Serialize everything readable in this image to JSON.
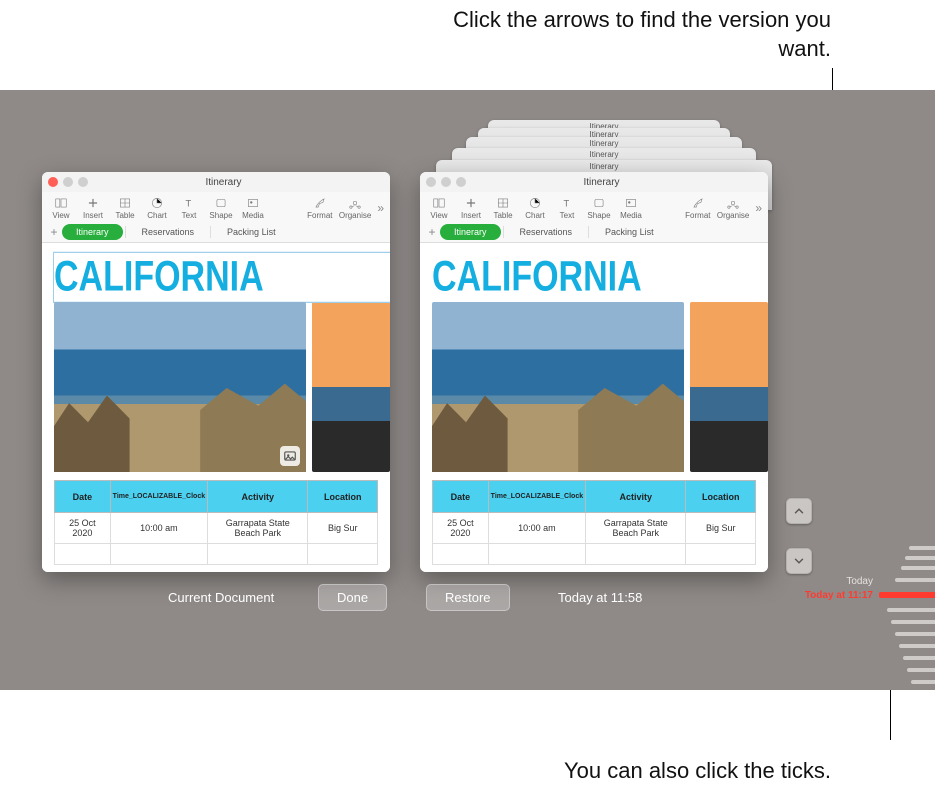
{
  "annotations": {
    "top": "Click the arrows to find the version you want.",
    "bottom": "You can also click the ticks."
  },
  "ghost_title": "Itinerary",
  "window": {
    "title": "Itinerary",
    "toolbar": {
      "view": "View",
      "insert": "Insert",
      "table": "Table",
      "chart": "Chart",
      "text": "Text",
      "shape": "Shape",
      "media": "Media",
      "format": "Format",
      "organise": "Organise"
    },
    "tabs": {
      "itinerary": "Itinerary",
      "reservations": "Reservations",
      "packing": "Packing List"
    },
    "heading": "CALIFORNIA",
    "table": {
      "headers": {
        "date": "Date",
        "time": "Time_LOCALIZABLE_Clock",
        "activity": "Activity",
        "location": "Location"
      },
      "row": {
        "date": "25 Oct 2020",
        "time": "10:00 am",
        "activity": "Garrapata State Beach Park",
        "location": "Big Sur"
      }
    }
  },
  "left": {
    "label": "Current Document",
    "button": "Done"
  },
  "right": {
    "button": "Restore",
    "label": "Today at 11:58"
  },
  "timeline": {
    "today": "Today",
    "selected": "Today at 11:17"
  }
}
